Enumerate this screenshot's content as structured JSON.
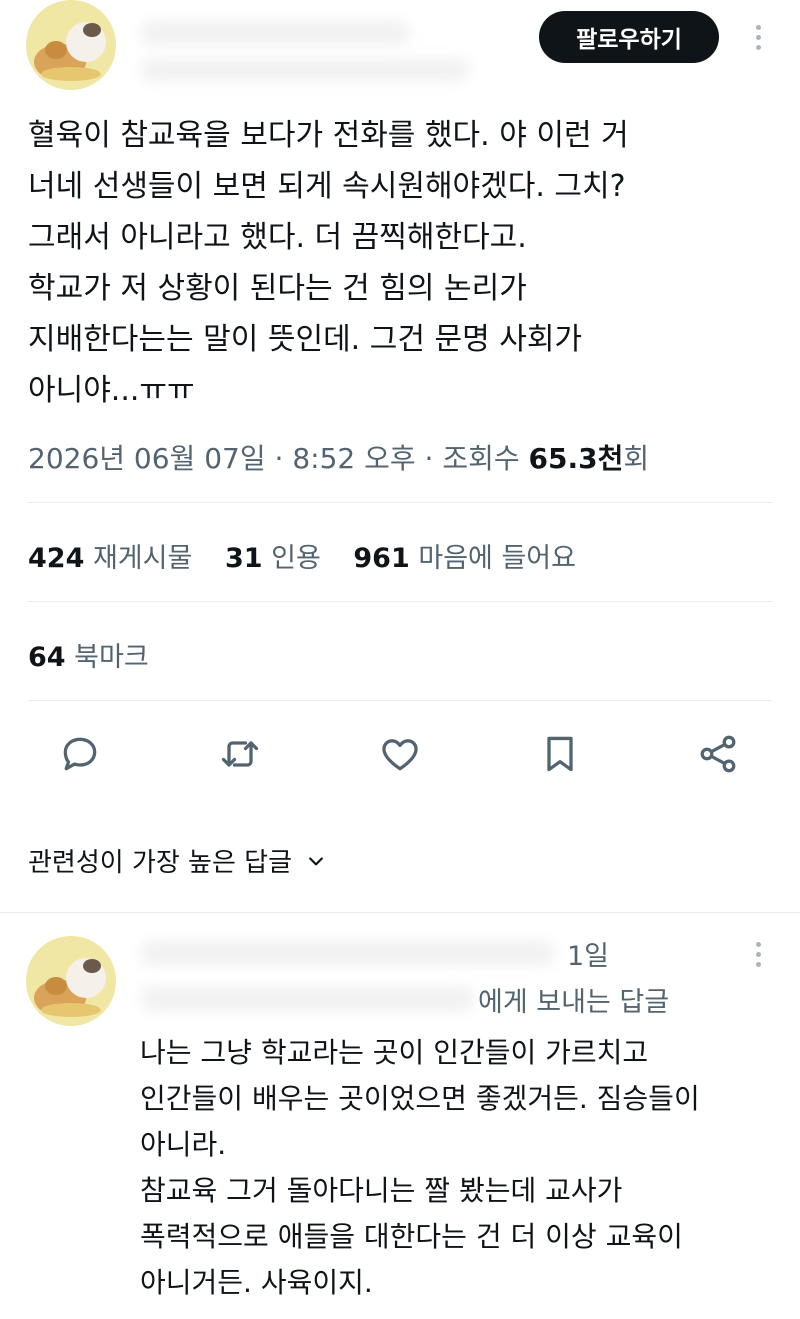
{
  "tweet": {
    "follow_label": "팔로우하기",
    "body_lines": [
      "혈육이 참교육을 보다가 전화를 했다. 야 이런 거",
      "너네 선생들이 보면 되게 속시원해야겠다. 그치?",
      "그래서 아니라고 했다. 더 끔찍해한다고.",
      "학교가 저 상황이 된다는 건 힘의 논리가",
      "지배한다는는 말이 뜻인데. 그건 문명 사회가",
      "아니야...ㅠㅠ"
    ],
    "date": "2026년 06월 07일",
    "time": "8:52 오후",
    "views_label": "조회수",
    "views_value": "65.3천",
    "views_suffix": "회"
  },
  "stats": {
    "retweets": {
      "value": "424",
      "label": "재게시물"
    },
    "quotes": {
      "value": "31",
      "label": "인용"
    },
    "likes": {
      "value": "961",
      "label": "마음에 들어요"
    },
    "bookmarks": {
      "value": "64",
      "label": "북마크"
    }
  },
  "actions": [
    "reply-icon",
    "retweet-icon",
    "heart-icon",
    "bookmark-icon",
    "share-icon"
  ],
  "sort": {
    "label": "관련성이 가장 높은 답글"
  },
  "reply": {
    "time": "1일",
    "reply_to_suffix": "에게 보내는 답글",
    "body_lines": [
      "나는 그냥 학교라는 곳이 인간들이 가르치고",
      "인간들이 배우는 곳이었으면 좋겠거든. 짐승들이",
      "아니라.",
      "참교육 그거 돌아다니는 짤 봤는데 교사가",
      "폭력적으로 애들을 대한다는 건 더 이상 교육이",
      "아니거든. 사육이지."
    ]
  },
  "colors": {
    "text": "#0f1419",
    "secondary": "#536471",
    "accent": "#1d9bf0",
    "divider": "#e6ecf0"
  }
}
